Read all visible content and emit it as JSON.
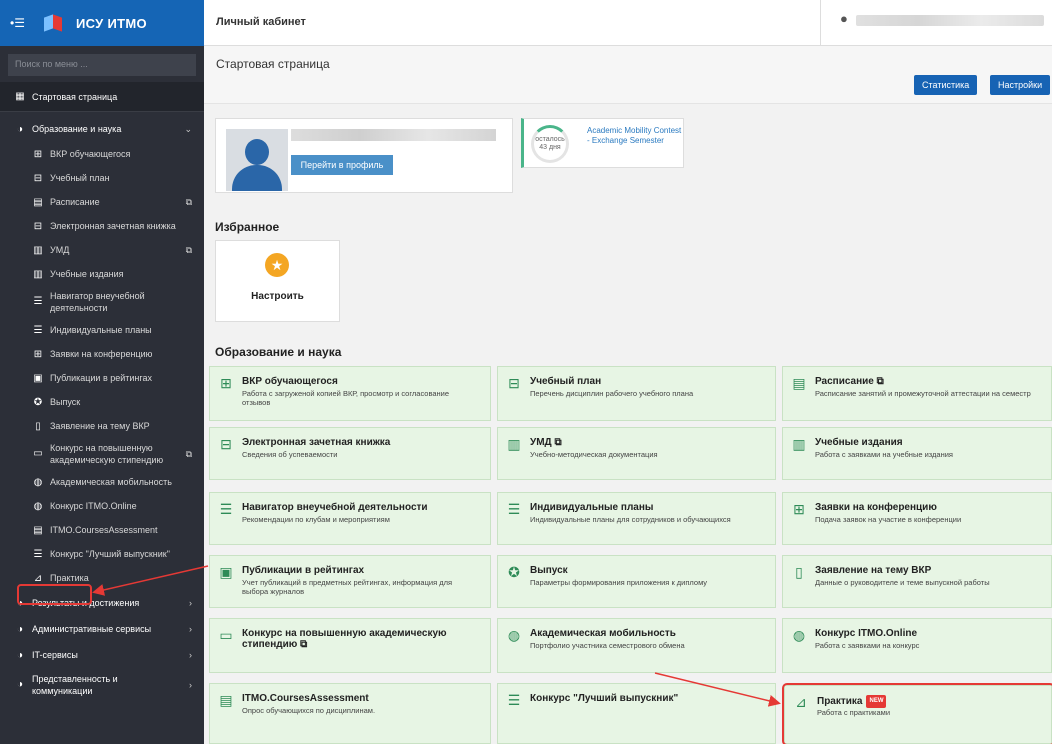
{
  "app": {
    "title": "ИСУ ИТМО"
  },
  "topbar": {
    "title": "Личный кабинет"
  },
  "sidebar": {
    "search_placeholder": "Поиск по меню ...",
    "items": [
      {
        "label": "Стартовая страница",
        "icon": "grid",
        "kind": "top"
      },
      {
        "label": "Образование и наука",
        "icon": "toggle",
        "kind": "section",
        "expanded": true
      },
      {
        "label": "ВКР обучающегося",
        "icon": "sitemap",
        "kind": "sub"
      },
      {
        "label": "Учебный план",
        "icon": "table",
        "kind": "sub"
      },
      {
        "label": "Расписание",
        "icon": "calendar",
        "kind": "sub",
        "external": true
      },
      {
        "label": "Электронная зачетная книжка",
        "icon": "table",
        "kind": "sub"
      },
      {
        "label": "УМД",
        "icon": "file",
        "kind": "sub",
        "external": true
      },
      {
        "label": "Учебные издания",
        "icon": "books",
        "kind": "sub"
      },
      {
        "label": "Навигатор внеучебной деятельности",
        "icon": "list",
        "kind": "sub"
      },
      {
        "label": "Индивидуальные планы",
        "icon": "list",
        "kind": "sub"
      },
      {
        "label": "Заявки на конференцию",
        "icon": "sitemap",
        "kind": "sub"
      },
      {
        "label": "Публикации в рейтингах",
        "icon": "doc",
        "kind": "sub"
      },
      {
        "label": "Выпуск",
        "icon": "medal",
        "kind": "sub"
      },
      {
        "label": "Заявление на тему ВКР",
        "icon": "book",
        "kind": "sub"
      },
      {
        "label": "Конкурс на повышенную академическую стипендию",
        "icon": "money",
        "kind": "sub",
        "external": true
      },
      {
        "label": "Академическая мобильность",
        "icon": "globe",
        "kind": "sub"
      },
      {
        "label": "Конкурс ITMO.Online",
        "icon": "globe",
        "kind": "sub"
      },
      {
        "label": "ITMO.CoursesAssessment",
        "icon": "clipboard",
        "kind": "sub"
      },
      {
        "label": "Конкурс \"Лучший выпускник\"",
        "icon": "list",
        "kind": "sub"
      },
      {
        "label": "Практика",
        "icon": "chart",
        "kind": "sub"
      },
      {
        "label": "Результаты и достижения",
        "icon": "toggle",
        "kind": "section"
      },
      {
        "label": "Административные сервисы",
        "icon": "toggle",
        "kind": "section"
      },
      {
        "label": "IT-сервисы",
        "icon": "toggle",
        "kind": "section"
      },
      {
        "label": "Представленность и коммуникации",
        "icon": "toggle",
        "kind": "section"
      }
    ]
  },
  "header": {
    "page_title": "Стартовая страница",
    "stats_button": "Статистика",
    "settings_button": "Настройки"
  },
  "profile": {
    "button": "Перейти в профиль"
  },
  "countdown": {
    "line1": "осталось",
    "line2": "43 дня",
    "link": "Academic Mobility Contest - Exchange Semester"
  },
  "favorites": {
    "heading": "Избранное",
    "tile_label": "Настроить"
  },
  "education": {
    "heading": "Образование и наука",
    "tiles": [
      {
        "title": "ВКР обучающегося",
        "desc": "Работа с загруженой копией ВКР, просмотр и согласование отзывов",
        "icon": "sitemap"
      },
      {
        "title": "Учебный план",
        "desc": "Перечень дисциплин рабочего учебного плана",
        "icon": "table"
      },
      {
        "title": "Расписание",
        "desc": "Расписание занятий и промежуточной аттестации на семестр",
        "icon": "calendar",
        "external": true
      },
      {
        "title": "Электронная зачетная книжка",
        "desc": "Сведения об успеваемости",
        "icon": "table"
      },
      {
        "title": "УМД",
        "desc": "Учебно-методическая документация",
        "icon": "file",
        "external": true
      },
      {
        "title": "Учебные издания",
        "desc": "Работа с заявками на учебные издания",
        "icon": "books"
      },
      {
        "title": "Навигатор внеучебной деятельности",
        "desc": "Рекомендации по клубам и мероприятиям",
        "icon": "list"
      },
      {
        "title": "Индивидуальные планы",
        "desc": "Индивидуальные планы для сотрудников и обучающихся",
        "icon": "list"
      },
      {
        "title": "Заявки на конференцию",
        "desc": "Подача заявок на участие в конференции",
        "icon": "sitemap"
      },
      {
        "title": "Публикации в рейтингах",
        "desc": "Учет публикаций в предметных рейтингах, информация для выбора журналов",
        "icon": "doc"
      },
      {
        "title": "Выпуск",
        "desc": "Параметры формирования приложения к диплому",
        "icon": "medal"
      },
      {
        "title": "Заявление на тему ВКР",
        "desc": "Данные о руководителе и теме выпускной работы",
        "icon": "book"
      },
      {
        "title": "Конкурс на повышенную академическую стипендию",
        "desc": "",
        "icon": "money",
        "external": true
      },
      {
        "title": "Академическая мобильность",
        "desc": "Портфолио участника семестрового обмена",
        "icon": "globe"
      },
      {
        "title": "Конкурс ITMO.Online",
        "desc": "Работа с заявками на конкурс",
        "icon": "globe"
      },
      {
        "title": "ITMO.CoursesAssessment",
        "desc": "Опрос обучающихся по дисциплинам.",
        "icon": "clipboard"
      },
      {
        "title": "Конкурс \"Лучший выпускник\"",
        "desc": "",
        "icon": "list"
      },
      {
        "title": "Практика",
        "desc": "Работа с практиками",
        "icon": "chart",
        "badge": "NEW"
      }
    ]
  },
  "colors": {
    "brand": "#1565b5",
    "sidebar": "#2c2f38",
    "tile": "#e7f5e4",
    "highlight": "#e53935"
  }
}
